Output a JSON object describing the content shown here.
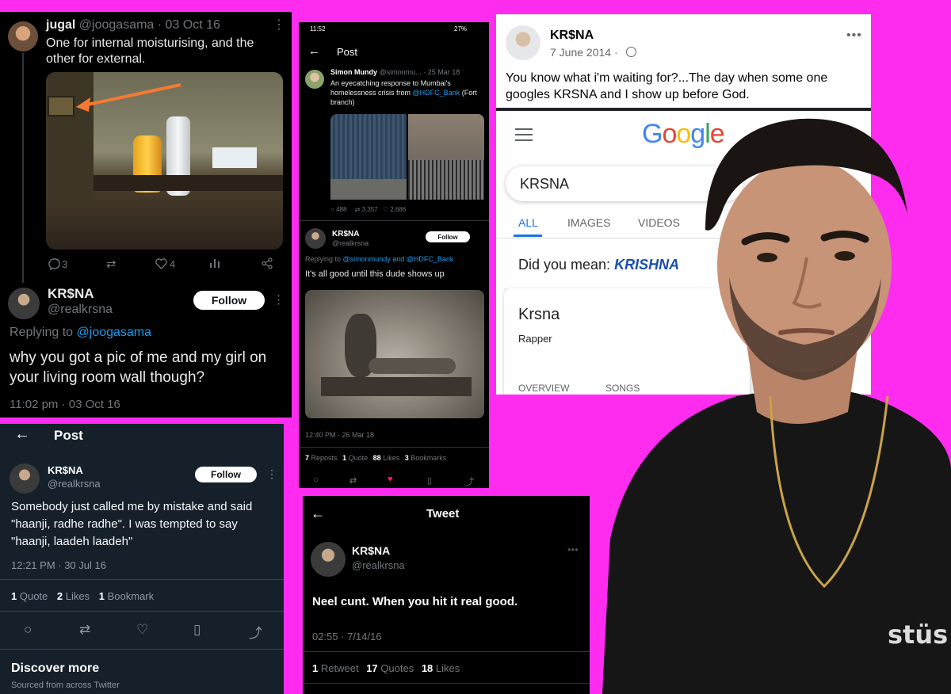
{
  "colors": {
    "background": "#ff2cf0",
    "twitter_blue": "#1d9bf0",
    "like_pink": "#f91880",
    "google_blue": "#1a73e8"
  },
  "panel1": {
    "name": "jugal",
    "handle": "@joogasama",
    "date": "· 03 Oct 16",
    "text": "One for internal moisturising, and the other for external.",
    "reply_count": "3",
    "like_count": "4",
    "reply_name": "KR$NA",
    "reply_handle": "@realkrsna",
    "follow_label": "Follow",
    "replying_prefix": "Replying to",
    "replying_handle": "@joogasama",
    "reply_text": "why you got a pic of me and my girl on your living room wall though?",
    "reply_time": "11:02 pm · 03 Oct 16"
  },
  "panel2": {
    "status_time": "11:52",
    "battery": "27%",
    "header_title": "Post",
    "quoted_name": "Simon Mundy",
    "quoted_handle": "@simonmu...",
    "quoted_date": "· 25 Mar 18",
    "quoted_text_1": "An eyecatching response to Mumbai's homelessness crisis from",
    "quoted_link": "@HDFC_Bank",
    "quoted_text_2": "(Fort branch)",
    "q_replies": "488",
    "q_retweets": "3,357",
    "q_likes": "2,686",
    "author_name": "KR$NA",
    "author_handle": "@realkrsna",
    "follow_label": "Follow",
    "replying_prefix": "Replying to",
    "replying_handles": "@simonmundy and @HDFC_Bank",
    "text": "It's all good until this dude shows up",
    "timestamp": "12:40 PM · 26 Mar 18",
    "reposts_count": "7",
    "reposts_label": "Reposts",
    "quote_count": "1",
    "quote_label": "Quote",
    "likes_count": "88",
    "likes_label": "Likes",
    "bookmarks_count": "3",
    "bookmarks_label": "Bookmarks"
  },
  "panel3": {
    "name": "KR$NA",
    "date": "7 June 2014 ·",
    "text": "You know what i'm waiting for?...The day when some one googles KRSNA and I show up before God.",
    "google_logo": "Google",
    "search_value": "KRSNA",
    "tabs": [
      "ALL",
      "IMAGES",
      "VIDEOS"
    ],
    "did_you_mean_prefix": "Did you mean:",
    "did_you_mean_term": "KRISHNA",
    "card_title": "Krsna",
    "card_subtitle": "Rapper",
    "bottom_tabs": [
      "OVERVIEW",
      "SONGS"
    ]
  },
  "panel4": {
    "header_title": "Post",
    "name": "KR$NA",
    "handle": "@realkrsna",
    "follow_label": "Follow",
    "text": "Somebody just called me by mistake and said \"haanji, radhe radhe\". I was tempted to say \"haanji, laadeh laadeh\"",
    "timestamp": "12:21 PM · 30 Jul 16",
    "quote_count": "1",
    "quote_label": "Quote",
    "likes_count": "2",
    "likes_label": "Likes",
    "bookmark_count": "1",
    "bookmark_label": "Bookmark",
    "discover_title": "Discover more",
    "discover_sub": "Sourced from across Twitter"
  },
  "panel5": {
    "header_title": "Tweet",
    "name": "KR$NA",
    "handle": "@realkrsna",
    "text": "Neel cunt. When you hit it real good.",
    "timestamp": "02:55 · 7/14/16",
    "retweet_count": "1",
    "retweet_label": "Retweet",
    "quotes_count": "17",
    "quotes_label": "Quotes",
    "likes_count": "18",
    "likes_label": "Likes"
  },
  "person": {
    "shirt_logo": "stüs"
  }
}
